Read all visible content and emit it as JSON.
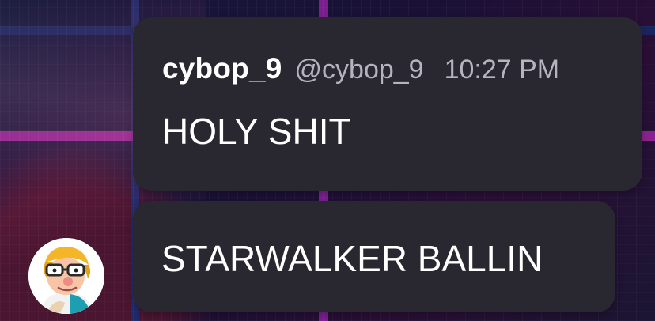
{
  "background": {
    "base": "#17183a",
    "accent_pink": "#8a238f",
    "accent_blue": "#202a68"
  },
  "messages": [
    {
      "author_name": "cybop_9",
      "author_handle": "@cybop_9",
      "timestamp": "10:27 PM",
      "text": "HOLY SHIT"
    },
    {
      "text": "STARWALKER BALLIN"
    }
  ],
  "avatar": {
    "icon": "cartoon-person-avatar-icon"
  }
}
